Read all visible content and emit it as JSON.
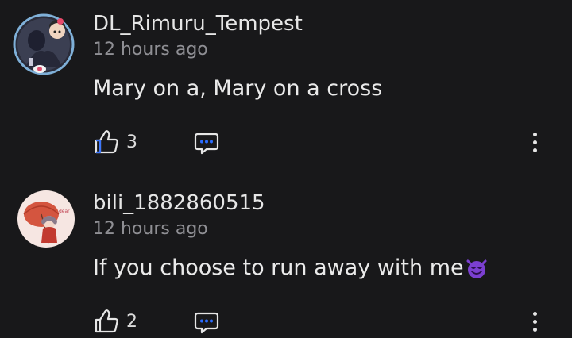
{
  "comments": [
    {
      "username": "DL_Rimuru_Tempest",
      "timestamp": "12 hours ago",
      "text": "Mary on a, Mary on a cross",
      "emoji": "",
      "likes": "3",
      "avatar_icon": "anime-avatar-icon"
    },
    {
      "username": "bili_1882860515",
      "timestamp": "12 hours ago",
      "text": "If you choose to run away with me",
      "emoji": "smiling-devil-emoji",
      "likes": "2",
      "avatar_icon": "anime-avatar-icon"
    }
  ],
  "colors": {
    "background": "#18181a",
    "accent": "#2b6bff",
    "muted_text": "#8f8f94",
    "emoji_purple": "#7b3fd0"
  }
}
